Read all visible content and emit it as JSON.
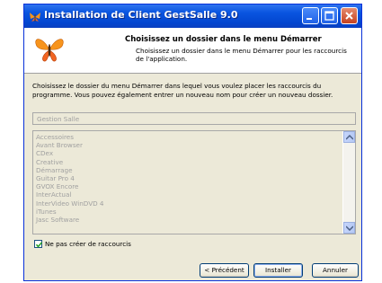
{
  "window": {
    "title": "Installation de Client GestSalle 9.0"
  },
  "header": {
    "title": "Choisissez un dossier dans le menu Démarrer",
    "subtitle": "Choisissez un dossier dans le menu Démarrer pour les raccourcis de l'application."
  },
  "body": {
    "description": "Choisissez le dossier du menu Démarrer dans lequel vous voulez placer les raccourcis du programme. Vous pouvez également entrer un nouveau nom pour créer un nouveau dossier.",
    "folder_name": "Gestion Salle",
    "folders": [
      "Accessoires",
      "Avant Browser",
      "CDex",
      "Creative",
      "Démarrage",
      "Guitar Pro 4",
      "GVOX Encore",
      "InterActual",
      "InterVideo WinDVD 4",
      "iTunes",
      "Jasc Software"
    ],
    "no_shortcuts_label": "Ne pas créer de raccourcis",
    "no_shortcuts_checked": true
  },
  "buttons": {
    "previous": "< Précédent",
    "install": "Installer",
    "cancel": "Annuler"
  },
  "colors": {
    "titlebar": "#0a55e0",
    "window_face": "#ece9d8",
    "disabled_text": "#a0a0a0"
  }
}
